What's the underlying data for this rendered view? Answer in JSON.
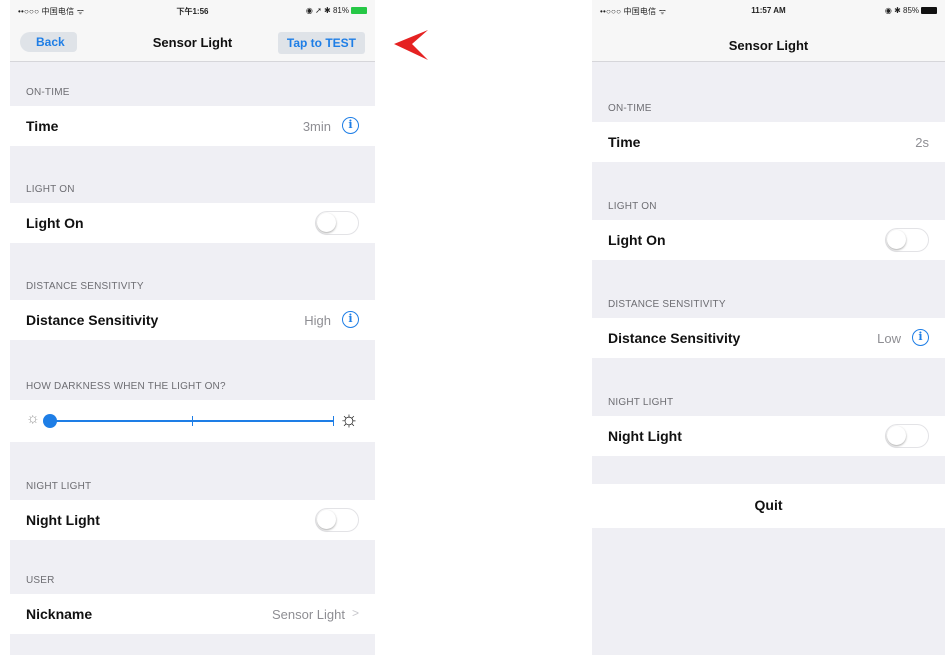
{
  "left": {
    "statusbar": {
      "carrier": "••○○○ 中国电信 ᯤ",
      "time": "下午1:56",
      "battery": "◉ ➚ ✱ 81%"
    },
    "navbar": {
      "back_label": "Back",
      "title": "Sensor Light",
      "test_label": "Tap to TEST"
    },
    "sections": {
      "on_time": "ON-TIME",
      "light_on": "LIGHT ON",
      "distance": "DISTANCE SENSITIVITY",
      "darkness": "HOW DARKNESS WHEN THE LIGHT ON?",
      "night_light": "NIGHT LIGHT",
      "user": "USER"
    },
    "rows": {
      "time": {
        "label": "Time",
        "value": "3min"
      },
      "light_on": {
        "label": "Light On",
        "on": false
      },
      "distance": {
        "label": "Distance Sensitivity",
        "value": "High"
      },
      "night_light": {
        "label": "Night Light",
        "on": false
      },
      "nickname": {
        "label": "Nickname",
        "value": "Sensor Light"
      }
    },
    "slider": {
      "value": 0,
      "steps": 3
    }
  },
  "right": {
    "statusbar": {
      "carrier": "••○○○ 中国电信 ᯤ",
      "time": "11:57 AM",
      "battery": "◉ ✱ 85%"
    },
    "navbar": {
      "title": "Sensor Light"
    },
    "sections": {
      "on_time": "ON-TIME",
      "light_on": "LIGHT ON",
      "distance": "DISTANCE SENSITIVITY",
      "night_light": "NIGHT LIGHT"
    },
    "rows": {
      "time": {
        "label": "Time",
        "value": "2s"
      },
      "light_on": {
        "label": "Light On",
        "on": false
      },
      "distance": {
        "label": "Distance Sensitivity",
        "value": "Low"
      },
      "night_light": {
        "label": "Night Light",
        "on": false
      }
    },
    "quit_label": "Quit"
  },
  "icons": {
    "info": "info-circle-icon",
    "sun_small": "sun-dim-icon",
    "sun_big": "sun-bright-icon",
    "chevron": "chevron-right-icon",
    "arrow": "red-arrow-marker-icon"
  },
  "colors": {
    "accent": "#1e7ee6",
    "background": "#efeff4",
    "marker": "#e52222"
  }
}
